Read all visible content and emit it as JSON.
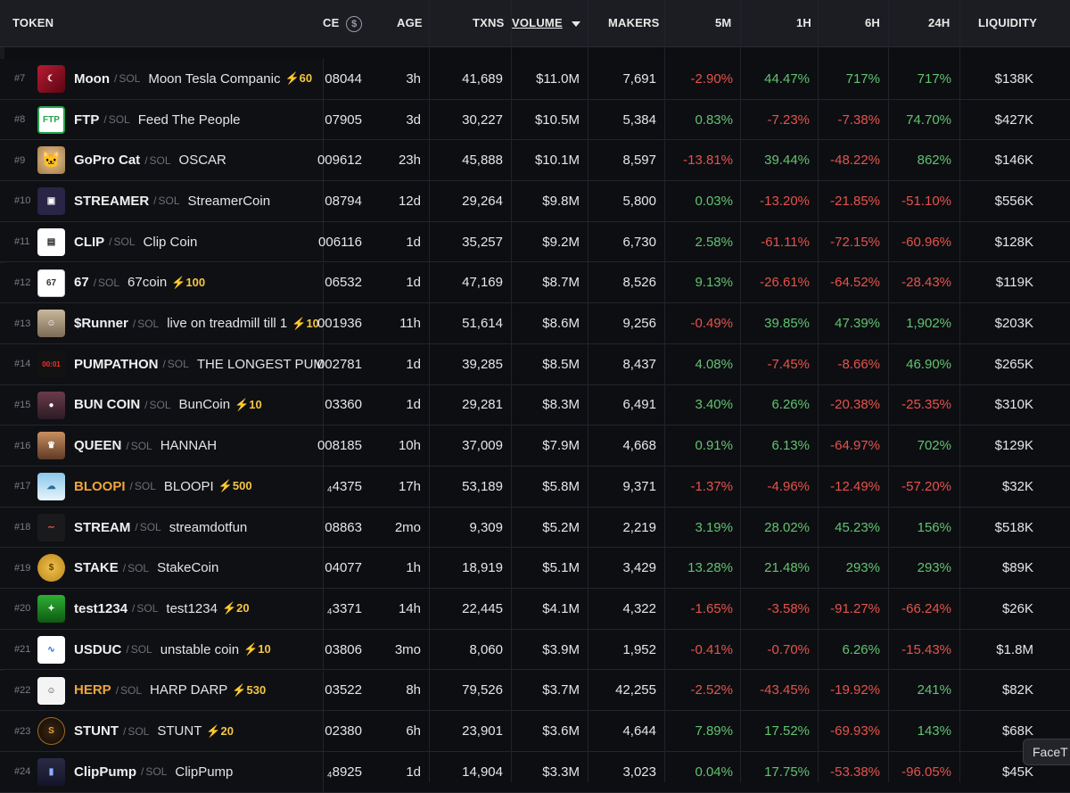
{
  "header": {
    "token": "TOKEN",
    "price_partial": "CE",
    "age": "AGE",
    "txns": "TXNS",
    "volume": "VOLUME",
    "makers": "MAKERS",
    "m5": "5M",
    "h1": "1H",
    "h6": "6H",
    "h24": "24H",
    "liquidity": "LIQUIDITY"
  },
  "colors": {
    "positive": "#62c370",
    "negative": "#e5534b",
    "boost": "#f5c542",
    "highlight_symbol": "#f0a53a"
  },
  "tooltip": "FaceT",
  "rows": [
    {
      "rank": "#7",
      "symbol": "Moon",
      "chain": "SOL",
      "name": "Moon Tesla Companic",
      "boost": "⚡60",
      "price": "08044",
      "age": "3h",
      "txns": "41,689",
      "volume": "$11.0M",
      "makers": "7,691",
      "m5": "-2.90%",
      "h1": "44.47%",
      "h6": "717%",
      "h24": "717%",
      "liquidity": "$138K",
      "icon": "moon-icon"
    },
    {
      "rank": "#8",
      "symbol": "FTP",
      "chain": "SOL",
      "name": "Feed The People",
      "boost": "",
      "price": "07905",
      "age": "3d",
      "txns": "30,227",
      "volume": "$10.5M",
      "makers": "5,384",
      "m5": "0.83%",
      "h1": "-7.23%",
      "h6": "-7.38%",
      "h24": "74.70%",
      "liquidity": "$427K",
      "icon": "ftp-logo-icon"
    },
    {
      "rank": "#9",
      "symbol": "GoPro Cat",
      "chain": "SOL",
      "name": "OSCAR",
      "boost": "",
      "price": "009612",
      "age": "23h",
      "txns": "45,888",
      "volume": "$10.1M",
      "makers": "8,597",
      "m5": "-13.81%",
      "h1": "39.44%",
      "h6": "-48.22%",
      "h24": "862%",
      "liquidity": "$146K",
      "icon": "cat-icon"
    },
    {
      "rank": "#10",
      "symbol": "STREAMER",
      "chain": "SOL",
      "name": "StreamerCoin",
      "boost": "",
      "price": "08794",
      "age": "12d",
      "txns": "29,264",
      "volume": "$9.8M",
      "makers": "5,800",
      "m5": "0.03%",
      "h1": "-13.20%",
      "h6": "-21.85%",
      "h24": "-51.10%",
      "liquidity": "$556K",
      "icon": "tv-icon"
    },
    {
      "rank": "#11",
      "symbol": "CLIP",
      "chain": "SOL",
      "name": "Clip Coin",
      "boost": "",
      "price": "006116",
      "age": "1d",
      "txns": "35,257",
      "volume": "$9.2M",
      "makers": "6,730",
      "m5": "2.58%",
      "h1": "-61.11%",
      "h6": "-72.15%",
      "h24": "-60.96%",
      "liquidity": "$128K",
      "icon": "clapper-icon"
    },
    {
      "rank": "#12",
      "symbol": "67",
      "chain": "SOL",
      "name": "67coin",
      "boost": "⚡100",
      "price": "06532",
      "age": "1d",
      "txns": "47,169",
      "volume": "$8.7M",
      "makers": "8,526",
      "m5": "9.13%",
      "h1": "-26.61%",
      "h6": "-64.52%",
      "h24": "-28.43%",
      "liquidity": "$119K",
      "icon": "sixty-seven-icon"
    },
    {
      "rank": "#13",
      "symbol": "$Runner",
      "chain": "SOL",
      "name": "live on treadmill till 1",
      "boost": "⚡10",
      "price": "001936",
      "age": "11h",
      "txns": "51,614",
      "volume": "$8.6M",
      "makers": "9,256",
      "m5": "-0.49%",
      "h1": "39.85%",
      "h6": "47.39%",
      "h24": "1,902%",
      "liquidity": "$203K",
      "icon": "runner-icon"
    },
    {
      "rank": "#14",
      "symbol": "PUMPATHON",
      "chain": "SOL",
      "name": "THE LONGEST PUMPF",
      "boost": "",
      "price": "002781",
      "age": "1d",
      "txns": "39,285",
      "volume": "$8.5M",
      "makers": "8,437",
      "m5": "4.08%",
      "h1": "-7.45%",
      "h6": "-8.66%",
      "h24": "46.90%",
      "liquidity": "$265K",
      "icon": "timer-icon"
    },
    {
      "rank": "#15",
      "symbol": "BUN COIN",
      "chain": "SOL",
      "name": "BunCoin",
      "boost": "⚡10",
      "price": "03360",
      "age": "1d",
      "txns": "29,281",
      "volume": "$8.3M",
      "makers": "6,491",
      "m5": "3.40%",
      "h1": "6.26%",
      "h6": "-20.38%",
      "h24": "-25.35%",
      "liquidity": "$310K",
      "icon": "bun-icon"
    },
    {
      "rank": "#16",
      "symbol": "QUEEN",
      "chain": "SOL",
      "name": "HANNAH",
      "boost": "",
      "price": "008185",
      "age": "10h",
      "txns": "37,009",
      "volume": "$7.9M",
      "makers": "4,668",
      "m5": "0.91%",
      "h1": "6.13%",
      "h6": "-64.97%",
      "h24": "702%",
      "liquidity": "$129K",
      "icon": "queen-icon"
    },
    {
      "rank": "#17",
      "symbol": "BLOOPI",
      "chain": "SOL",
      "name": "BLOOPI",
      "boost": "⚡500",
      "price": "₄4375",
      "age": "17h",
      "txns": "53,189",
      "volume": "$5.8M",
      "makers": "9,371",
      "m5": "-1.37%",
      "h1": "-4.96%",
      "h6": "-12.49%",
      "h24": "-57.20%",
      "liquidity": "$32K",
      "icon": "bloopi-icon"
    },
    {
      "rank": "#18",
      "symbol": "STREAM",
      "chain": "SOL",
      "name": "streamdotfun",
      "boost": "",
      "price": "08863",
      "age": "2mo",
      "txns": "9,309",
      "volume": "$5.2M",
      "makers": "2,219",
      "m5": "3.19%",
      "h1": "28.02%",
      "h6": "45.23%",
      "h24": "156%",
      "liquidity": "$518K",
      "icon": "wave-icon"
    },
    {
      "rank": "#19",
      "symbol": "STAKE",
      "chain": "SOL",
      "name": "StakeCoin",
      "boost": "",
      "price": "04077",
      "age": "1h",
      "txns": "18,919",
      "volume": "$5.1M",
      "makers": "3,429",
      "m5": "13.28%",
      "h1": "21.48%",
      "h6": "293%",
      "h24": "293%",
      "liquidity": "$89K",
      "icon": "stake-coin-icon"
    },
    {
      "rank": "#20",
      "symbol": "test1234",
      "chain": "SOL",
      "name": "test1234",
      "boost": "⚡20",
      "price": "₄3371",
      "age": "14h",
      "txns": "22,445",
      "volume": "$4.1M",
      "makers": "4,322",
      "m5": "-1.65%",
      "h1": "-3.58%",
      "h6": "-91.27%",
      "h24": "-66.24%",
      "liquidity": "$26K",
      "icon": "test-icon"
    },
    {
      "rank": "#21",
      "symbol": "USDUC",
      "chain": "SOL",
      "name": "unstable coin",
      "boost": "⚡10",
      "price": "03806",
      "age": "3mo",
      "txns": "8,060",
      "volume": "$3.9M",
      "makers": "1,952",
      "m5": "-0.41%",
      "h1": "-0.70%",
      "h6": "6.26%",
      "h24": "-15.43%",
      "liquidity": "$1.8M",
      "icon": "usduc-icon"
    },
    {
      "rank": "#22",
      "symbol": "HERP",
      "chain": "SOL",
      "name": "HARP DARP",
      "boost": "⚡530",
      "price": "03522",
      "age": "8h",
      "txns": "79,526",
      "volume": "$3.7M",
      "makers": "42,255",
      "m5": "-2.52%",
      "h1": "-43.45%",
      "h6": "-19.92%",
      "h24": "241%",
      "liquidity": "$82K",
      "icon": "herp-icon"
    },
    {
      "rank": "#23",
      "symbol": "STUNT",
      "chain": "SOL",
      "name": "STUNT",
      "boost": "⚡20",
      "price": "02380",
      "age": "6h",
      "txns": "23,901",
      "volume": "$3.6M",
      "makers": "4,644",
      "m5": "7.89%",
      "h1": "17.52%",
      "h6": "-69.93%",
      "h24": "143%",
      "liquidity": "$68K",
      "icon": "stunt-icon"
    },
    {
      "rank": "#24",
      "symbol": "ClipPump",
      "chain": "SOL",
      "name": "ClipPump",
      "boost": "",
      "price": "₄8925",
      "age": "1d",
      "txns": "14,904",
      "volume": "$3.3M",
      "makers": "3,023",
      "m5": "0.04%",
      "h1": "17.75%",
      "h6": "-53.38%",
      "h24": "-96.05%",
      "liquidity": "$45K",
      "icon": "clippump-icon"
    }
  ]
}
